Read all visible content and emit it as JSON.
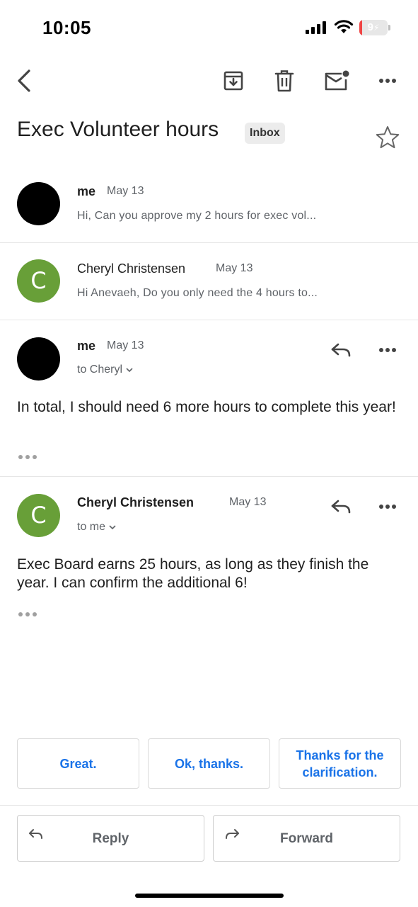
{
  "status_bar": {
    "time": "10:05",
    "battery_label": "9",
    "battery_level": 0.09,
    "battery_color": "#f04545"
  },
  "toolbar": {
    "icons": [
      "back-chevron-icon",
      "archive-icon",
      "trash-icon",
      "mark-unread-icon",
      "more-vert-icon"
    ]
  },
  "thread": {
    "subject": "Exec Volunteer hours",
    "label": "Inbox",
    "starred": false
  },
  "messages": [
    {
      "sender": "me",
      "date": "May 13",
      "snippet": "Hi, Can you approve my 2 hours for exec vol...",
      "avatar_initial": "",
      "avatar_color": "#000000",
      "expanded": false
    },
    {
      "sender": "Cheryl Christensen",
      "date": "May 13",
      "snippet": "Hi Anevaeh, Do you only need the 4 hours to...",
      "avatar_initial": "C",
      "avatar_color": "#689f38",
      "expanded": false
    },
    {
      "sender": "me",
      "date": "May 13",
      "recipient_line": "to Cheryl",
      "body": "In total, I should need 6 more hours to complete this year!",
      "avatar_initial": "",
      "avatar_color": "#000000",
      "expanded": true
    },
    {
      "sender": "Cheryl Christensen",
      "date": "May 13",
      "recipient_line": "to me",
      "body": "Exec Board earns 25 hours, as long as they finish the year.  I can confirm the additional 6!",
      "avatar_initial": "C",
      "avatar_color": "#689f38",
      "expanded": true
    }
  ],
  "smart_replies": [
    "Great.",
    "Ok, thanks.",
    "Thanks for the clarification."
  ],
  "actions": {
    "reply_label": "Reply",
    "forward_label": "Forward"
  },
  "colors": {
    "accent_blue": "#1a73e8",
    "secondary_text": "#5f6368",
    "divider": "#e6e6e6"
  }
}
